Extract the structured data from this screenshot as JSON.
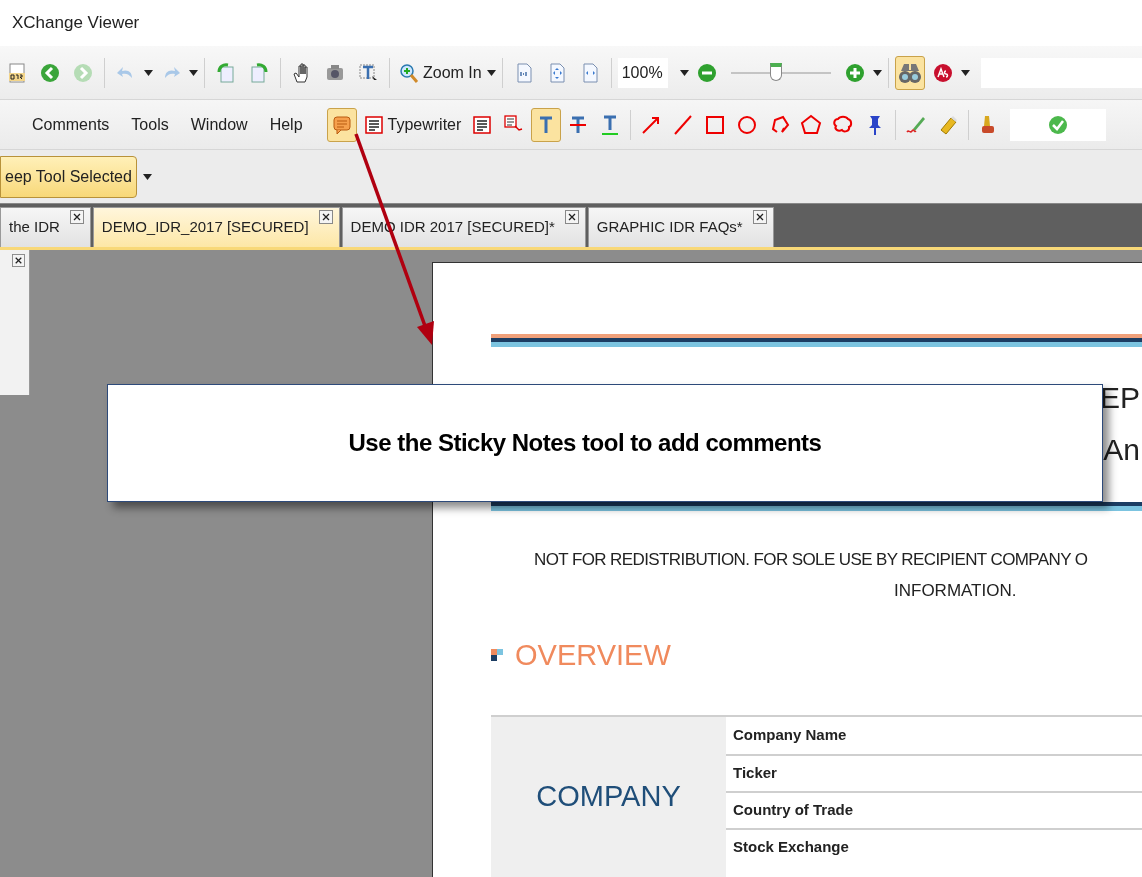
{
  "window": {
    "title": "XChange Viewer"
  },
  "toolbar": {
    "zoom_tool_label": "Zoom In",
    "zoom_value": "100%",
    "zoom_slider": {
      "level": 0.45
    },
    "find_tool": {
      "selected": true
    }
  },
  "menu": [
    "Comments",
    "Tools",
    "Window",
    "Help"
  ],
  "comment_tools": [
    {
      "kind": "sticky-note",
      "selected": true
    },
    {
      "kind": "typewriter",
      "label": "Typewriter",
      "selected": false
    },
    {
      "kind": "textbox",
      "selected": false
    },
    {
      "kind": "callout",
      "selected": false
    },
    {
      "kind": "text-highlight",
      "selected": true
    },
    {
      "kind": "strikeout",
      "selected": false
    },
    {
      "kind": "underline",
      "selected": false
    },
    {
      "kind": "arrow",
      "selected": false
    },
    {
      "kind": "line",
      "selected": false
    },
    {
      "kind": "rectangle",
      "selected": false
    },
    {
      "kind": "oval",
      "selected": false
    },
    {
      "kind": "polyline",
      "selected": false
    },
    {
      "kind": "polygon",
      "selected": false
    },
    {
      "kind": "cloud",
      "selected": false
    },
    {
      "kind": "pin",
      "selected": false
    },
    {
      "kind": "pencil",
      "selected": false
    },
    {
      "kind": "eraser",
      "selected": false
    },
    {
      "kind": "stamp",
      "selected": false
    }
  ],
  "keep_tool_selected": {
    "label": "eep Tool Selected",
    "selected": true
  },
  "tabs": [
    {
      "label": "the IDR",
      "selected": false
    },
    {
      "label": "DEMO_IDR_2017 [SECURED]",
      "selected": true
    },
    {
      "label": "DEMO IDR 2017 [SECURED]*",
      "selected": false
    },
    {
      "label": "GRAPHIC IDR FAQs*",
      "selected": false
    }
  ],
  "callout": {
    "text": "Use the Sticky Notes tool to add comments"
  },
  "document": {
    "title_fragments": [
      "EP",
      "An"
    ],
    "notice": [
      "NOT FOR REDISTRIBUTION. FOR SOLE USE BY RECIPIENT COMPANY O",
      "INFORMATION."
    ],
    "section_heading": "OVERVIEW",
    "table": {
      "group_label": "COMPANY",
      "fields": [
        "Company Name",
        "Ticker",
        "Country of Trade",
        "Stock Exchange"
      ]
    }
  }
}
